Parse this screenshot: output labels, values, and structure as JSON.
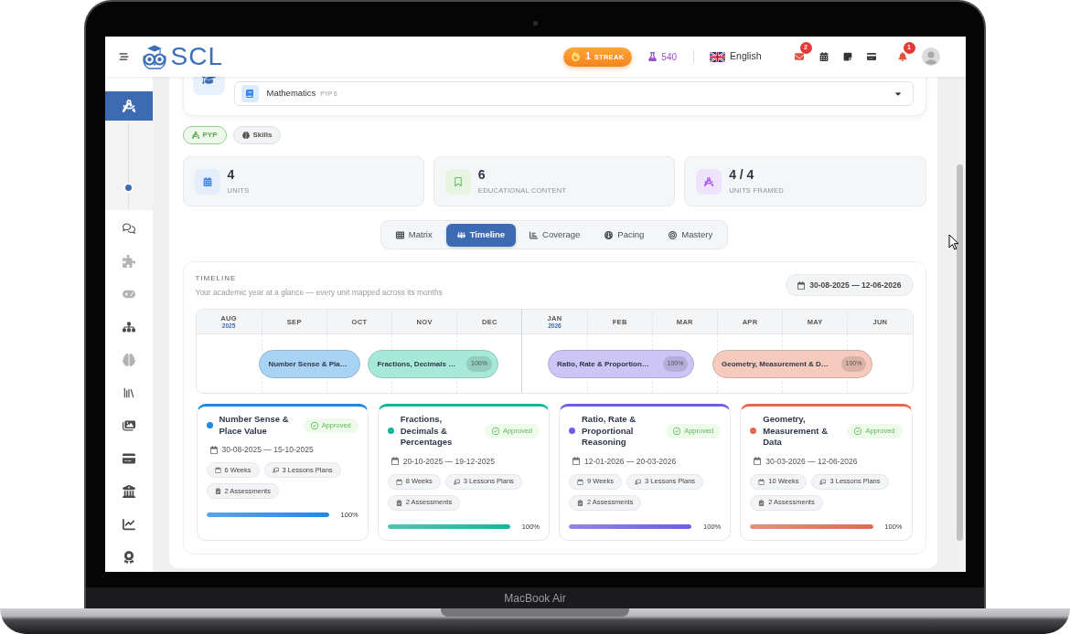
{
  "device": {
    "label": "MacBook Air"
  },
  "header": {
    "logo_text": "SCL",
    "streak": {
      "count": "1",
      "label": "STREAK"
    },
    "points": "540",
    "language": "English",
    "icons": [
      {
        "kind": "mail",
        "badge": "2"
      },
      {
        "kind": "calendar"
      },
      {
        "kind": "note"
      },
      {
        "kind": "wallet"
      },
      {
        "kind": "bell",
        "badge": "1"
      }
    ]
  },
  "sidebar": {
    "items": [
      {
        "kind": "compass",
        "selected": true,
        "expanded": true,
        "disabled": false
      },
      {
        "kind": "chat",
        "selected": false,
        "expanded": false,
        "disabled": false
      },
      {
        "kind": "puzzle",
        "selected": false,
        "expanded": false,
        "disabled": true
      },
      {
        "kind": "gamepad",
        "selected": false,
        "expanded": false,
        "disabled": true
      },
      {
        "kind": "hierarchy",
        "selected": false,
        "expanded": false,
        "disabled": false
      },
      {
        "kind": "brain",
        "selected": false,
        "expanded": false,
        "disabled": true
      },
      {
        "kind": "books",
        "selected": false,
        "expanded": false,
        "disabled": false
      },
      {
        "kind": "images",
        "selected": false,
        "expanded": false,
        "disabled": false
      },
      {
        "kind": "card",
        "selected": false,
        "expanded": false,
        "disabled": false
      },
      {
        "kind": "bank",
        "selected": false,
        "expanded": false,
        "disabled": false
      },
      {
        "kind": "chart",
        "selected": false,
        "expanded": false,
        "disabled": false
      },
      {
        "kind": "award",
        "selected": false,
        "expanded": false,
        "disabled": false
      }
    ]
  },
  "subject_select": {
    "value": "Mathematics",
    "tag": "PYP 6"
  },
  "frameworks": [
    {
      "kind": "compass",
      "label": "PYP",
      "selected": true
    },
    {
      "kind": "brain",
      "label": "Skills",
      "selected": false
    }
  ],
  "stats": [
    {
      "kind": "calendar",
      "value": "4",
      "label": "UNITS"
    },
    {
      "kind": "bookmark",
      "value": "6",
      "label": "EDUCATIONAL CONTENT"
    },
    {
      "kind": "compass",
      "value": "4 / 4",
      "label": "UNITS FRAMED"
    }
  ],
  "view_tabs": [
    {
      "kind": "grid",
      "label": "Matrix",
      "selected": false
    },
    {
      "kind": "timeline",
      "label": "Timeline",
      "selected": true
    },
    {
      "kind": "coverage",
      "label": "Coverage",
      "selected": false
    },
    {
      "kind": "pacing",
      "label": "Pacing",
      "selected": false
    },
    {
      "kind": "mastery",
      "label": "Mastery",
      "selected": false
    }
  ],
  "timeline": {
    "title": "TIMELINE",
    "subtitle": "Your academic year at a glance — every unit mapped across its months",
    "range": "30-08-2025 — 12-06-2026",
    "months": [
      {
        "label": "AUG",
        "year": "2025"
      },
      {
        "label": "SEP"
      },
      {
        "label": "OCT"
      },
      {
        "label": "NOV"
      },
      {
        "label": "DEC"
      },
      {
        "label": "JAN",
        "year": "2026"
      },
      {
        "label": "FEB"
      },
      {
        "label": "MAR"
      },
      {
        "label": "APR"
      },
      {
        "label": "MAY"
      },
      {
        "label": "JUN"
      }
    ],
    "bars": [
      {
        "label": "Number Sense & Pla…",
        "color": "#a9d3f5"
      },
      {
        "label": "Fractions, Decimals …",
        "percent": "100%",
        "color": "#a6e9d8"
      },
      {
        "label": "Ratio, Rate & Proportion…",
        "percent": "100%",
        "color": "#ccc5f6"
      },
      {
        "label": "Geometry, Measurement & D…",
        "percent": "100%",
        "color": "#f6cabd"
      }
    ],
    "units": [
      {
        "title": "Number Sense & Place Value",
        "status": "Approved",
        "dates": "30-08-2025 — 15-10-2025",
        "chips": [
          {
            "kind": "weeks",
            "label": "6 Weeks"
          },
          {
            "kind": "lessons",
            "label": "3 Lessons Plans"
          },
          {
            "kind": "assessments",
            "label": "2 Assessments"
          }
        ],
        "level": 1,
        "progress": "100%",
        "color": "#1e88e5"
      },
      {
        "title": "Fractions, Decimals & Percentages",
        "status": "Approved",
        "dates": "20-10-2025 — 19-12-2025",
        "chips": [
          {
            "kind": "weeks",
            "label": "8 Weeks"
          },
          {
            "kind": "lessons",
            "label": "3 Lessons Plans"
          },
          {
            "kind": "assessments",
            "label": "2 Assessments"
          }
        ],
        "level": 1,
        "progress": "100%",
        "color": "#12b595"
      },
      {
        "title": "Ratio, Rate & Proportional Reasoning",
        "status": "Approved",
        "dates": "12-01-2026 — 20-03-2026",
        "chips": [
          {
            "kind": "weeks",
            "label": "9 Weeks"
          },
          {
            "kind": "lessons",
            "label": "3 Lessons Plans"
          },
          {
            "kind": "assessments",
            "label": "2 Assessments"
          }
        ],
        "level": 1,
        "progress": "100%",
        "color": "#6d5ce8"
      },
      {
        "title": "Geometry, Measurement & Data",
        "status": "Approved",
        "dates": "30-03-2026 — 12-06-2026",
        "chips": [
          {
            "kind": "weeks",
            "label": "10 Weeks"
          },
          {
            "kind": "lessons",
            "label": "3 Lessons Plans"
          },
          {
            "kind": "assessments",
            "label": "2 Assessments"
          }
        ],
        "level": 1,
        "progress": "100%",
        "color": "#e2694f"
      }
    ]
  }
}
